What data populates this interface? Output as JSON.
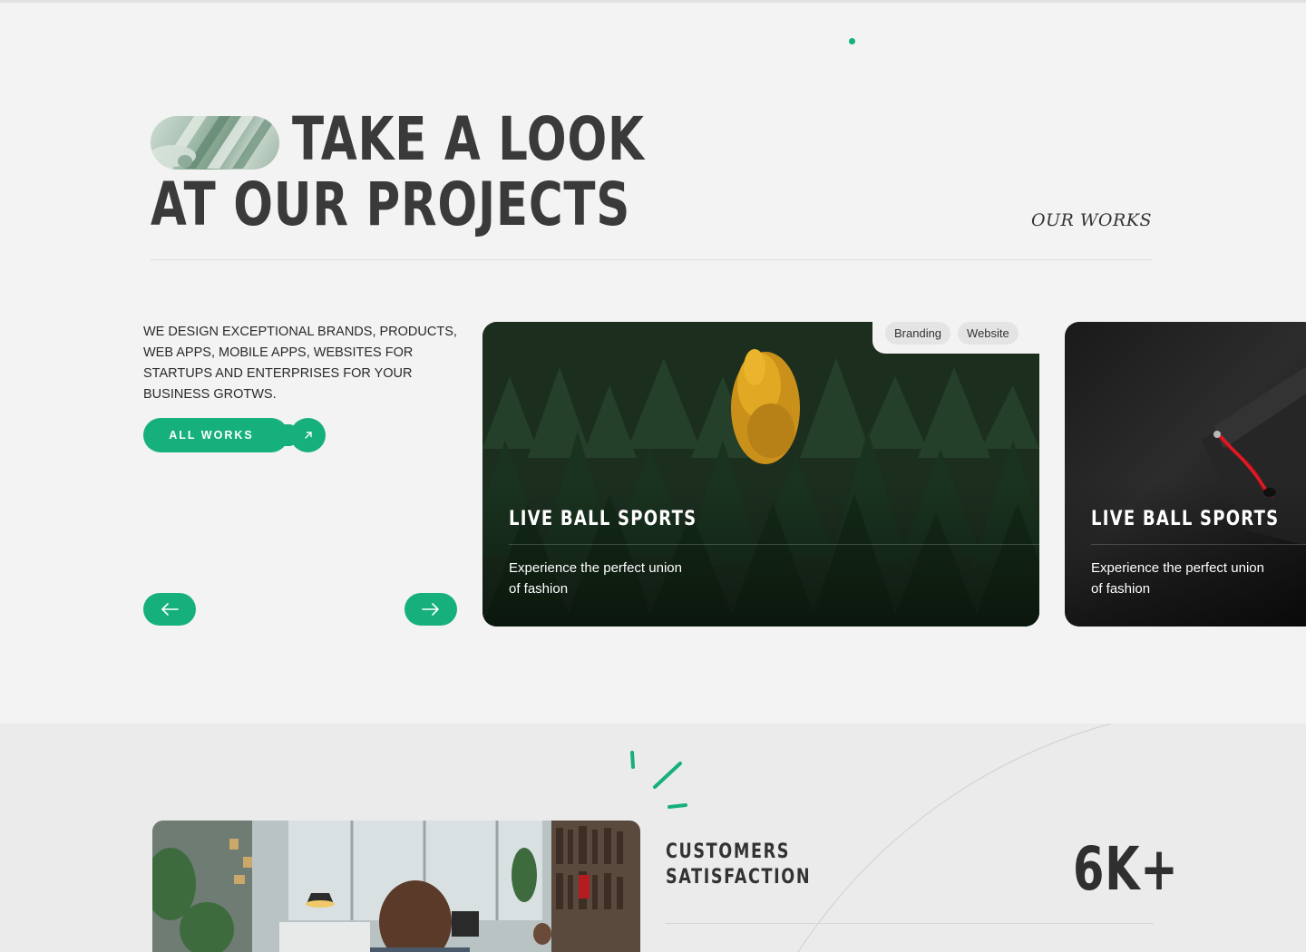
{
  "colors": {
    "accent": "#16b07d",
    "background": "#f3f3f3",
    "section_bg": "#ebebeb",
    "text": "#2b2b2b"
  },
  "header": {
    "title_line1": "TAKE A LOOK",
    "title_line2": "AT OUR PROJECTS",
    "section_label": "OUR WORKS"
  },
  "intro": {
    "text": "WE DESIGN EXCEPTIONAL BRANDS, PRODUCTS, WEB APPS, MOBILE APPS, WEBSITES FOR STARTUPS AND ENTERPRISES FOR YOUR BUSINESS GROTWS.",
    "cta_label": "ALL WORKS",
    "cta_icon": "arrow-up-right-icon"
  },
  "slider": {
    "prev_icon": "arrow-left-icon",
    "next_icon": "arrow-right-icon",
    "cards": [
      {
        "title": "LIVE BALL SPORTS",
        "description": "Experience the perfect union of fashion",
        "tags": [
          "Branding",
          "Website"
        ],
        "image": "forest-yellow-tree"
      },
      {
        "title": "LIVE BALL SPORTS",
        "description": "Experience the perfect union of fashion",
        "image": "graduation-cap-dark"
      }
    ]
  },
  "stats": {
    "label_line1": "CUSTOMERS",
    "label_line2": "SATISFACTION",
    "value": "6K+",
    "image": "office-workspace"
  }
}
